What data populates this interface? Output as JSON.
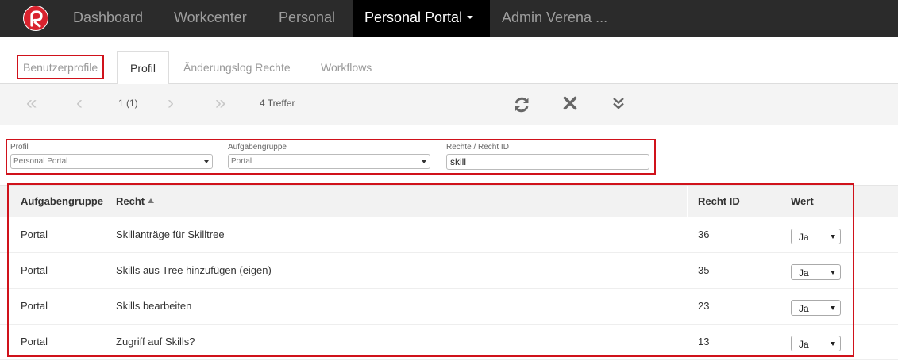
{
  "navbar": {
    "items": [
      {
        "label": "Dashboard"
      },
      {
        "label": "Workcenter"
      },
      {
        "label": "Personal"
      },
      {
        "label": "Personal Portal"
      },
      {
        "label": "Admin Verena ..."
      }
    ]
  },
  "colors": {
    "navbar_bg": "#2b2b2b",
    "active_nav_bg": "#000000",
    "brand_red": "#d9232e",
    "highlight_red": "#d0121b"
  },
  "tabs": [
    {
      "label": "Benutzerprofile"
    },
    {
      "label": "Profil"
    },
    {
      "label": "Änderungslog Rechte"
    },
    {
      "label": "Workflows"
    }
  ],
  "toolbar": {
    "page": "1 (1)",
    "results": "4 Treffer",
    "icons": [
      "first-page-icon",
      "prev-page-icon",
      "next-page-icon",
      "last-page-icon",
      "refresh-icon",
      "clear-icon",
      "expand-icon"
    ]
  },
  "filters": {
    "profil": {
      "label": "Profil",
      "value": "Personal Portal"
    },
    "aufgabengruppe": {
      "label": "Aufgabengruppe",
      "value": "Portal"
    },
    "recht": {
      "label": "Rechte / Recht ID",
      "value": "skill"
    }
  },
  "table": {
    "headers": [
      "Aufgabengruppe",
      "Recht",
      "Recht ID",
      "Wert"
    ],
    "rows": [
      {
        "gruppe": "Portal",
        "recht": "Skillanträge für Skilltree",
        "id": "36",
        "wert": "Ja"
      },
      {
        "gruppe": "Portal",
        "recht": "Skills aus Tree hinzufügen (eigen)",
        "id": "35",
        "wert": "Ja"
      },
      {
        "gruppe": "Portal",
        "recht": "Skills bearbeiten",
        "id": "23",
        "wert": "Ja"
      },
      {
        "gruppe": "Portal",
        "recht": "Zugriff auf Skills?",
        "id": "13",
        "wert": "Ja"
      }
    ]
  }
}
